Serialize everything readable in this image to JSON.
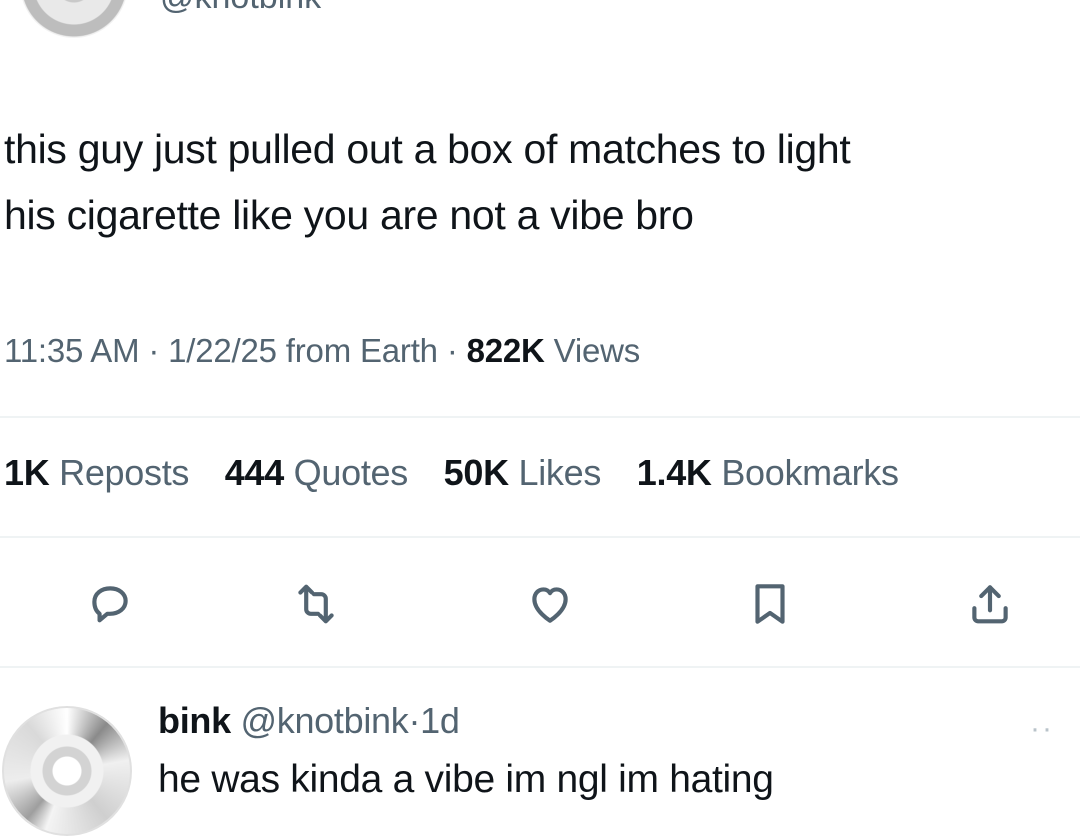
{
  "header": {
    "handle": "@knotbink"
  },
  "tweet": {
    "text_line1": "this guy just pulled out a box of matches to light",
    "text_line2": "his cigarette like you are not a vibe bro",
    "time": "11:35 AM",
    "date": "1/22/25",
    "source": "from Earth",
    "views_count": "822K",
    "views_label": "Views",
    "separator": "·"
  },
  "stats": [
    {
      "count": "1K",
      "label": "Reposts"
    },
    {
      "count": "444",
      "label": "Quotes"
    },
    {
      "count": "50K",
      "label": "Likes"
    },
    {
      "count": "1.4K",
      "label": "Bookmarks"
    }
  ],
  "actions": {
    "icons": [
      "reply-icon",
      "repost-icon",
      "like-icon",
      "bookmark-icon",
      "share-icon"
    ],
    "icon_color": "#536471"
  },
  "reply": {
    "name": "bink",
    "handle": "@knotbink",
    "separator": "·",
    "age": "1d",
    "text": "he was kinda a vibe im ngl im hating",
    "more": "··"
  },
  "colors": {
    "text": "#0f1419",
    "secondary": "#536471",
    "divider": "#eff3f4"
  }
}
